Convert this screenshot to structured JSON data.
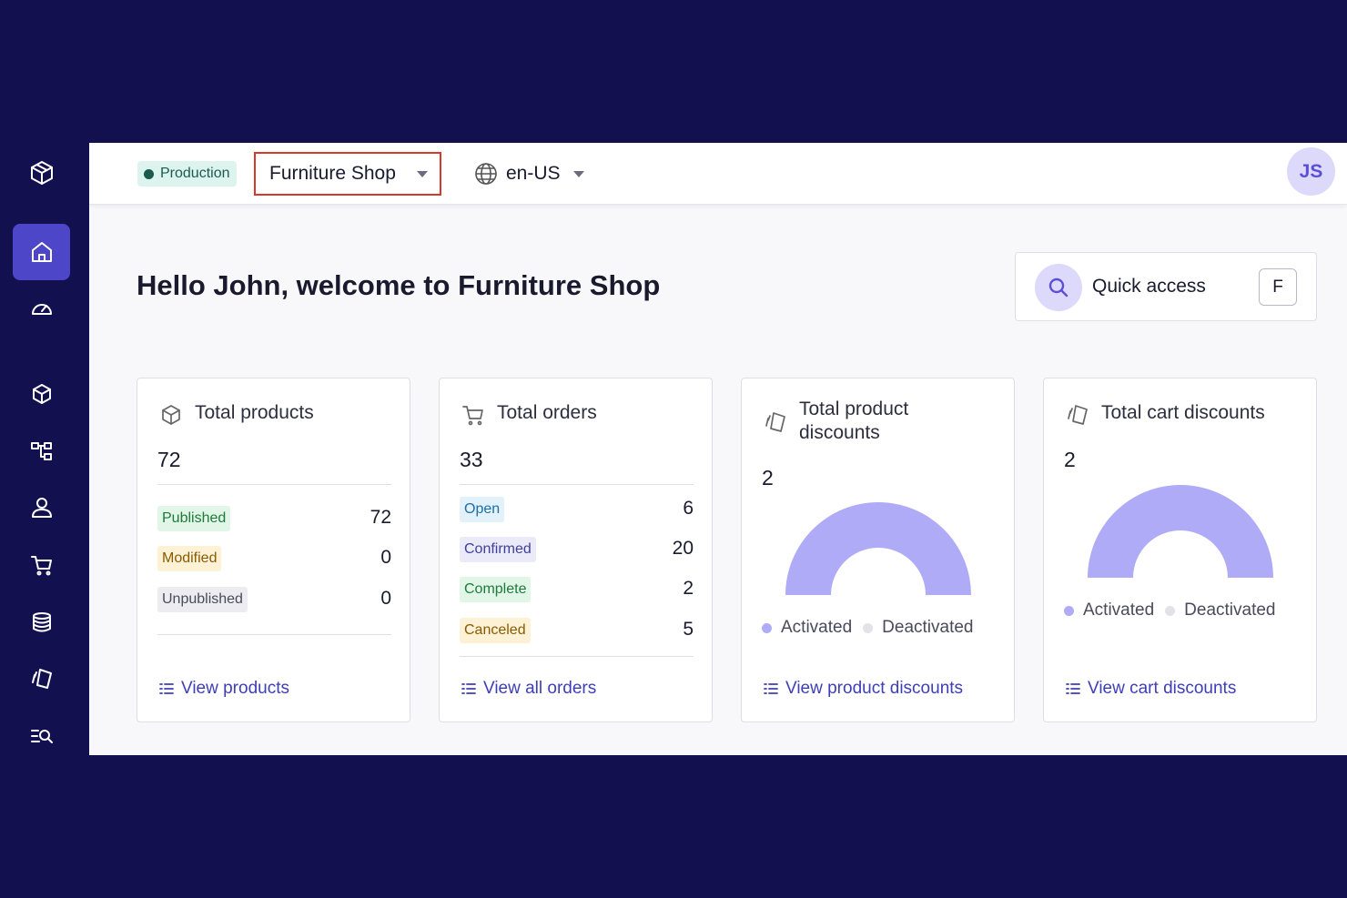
{
  "sidebar": {
    "items": [
      {
        "name": "logo",
        "icon": "cube-logo-icon"
      },
      {
        "name": "dashboard",
        "icon": "home-icon",
        "active": true
      },
      {
        "name": "performance",
        "icon": "speedometer-icon"
      },
      {
        "name": "products",
        "icon": "box-icon"
      },
      {
        "name": "categories",
        "icon": "tree-icon"
      },
      {
        "name": "customers",
        "icon": "person-icon"
      },
      {
        "name": "orders",
        "icon": "cart-icon"
      },
      {
        "name": "prices",
        "icon": "coins-icon"
      },
      {
        "name": "discounts",
        "icon": "discount-tag-icon"
      },
      {
        "name": "search",
        "icon": "list-search-icon"
      }
    ]
  },
  "topbar": {
    "environment": "Production",
    "project": "Furniture Shop",
    "locale": "en-US",
    "avatar_initials": "JS"
  },
  "main": {
    "welcome": "Hello John, welcome to Furniture Shop",
    "quick_access": {
      "label": "Quick access",
      "shortcut": "F"
    }
  },
  "cards": {
    "products": {
      "title": "Total products",
      "total": "72",
      "rows": [
        {
          "label": "Published",
          "count": "72"
        },
        {
          "label": "Modified",
          "count": "0"
        },
        {
          "label": "Unpublished",
          "count": "0"
        }
      ],
      "link": "View products"
    },
    "orders": {
      "title": "Total orders",
      "total": "33",
      "rows": [
        {
          "label": "Open",
          "count": "6"
        },
        {
          "label": "Confirmed",
          "count": "20"
        },
        {
          "label": "Complete",
          "count": "2"
        },
        {
          "label": "Canceled",
          "count": "5"
        }
      ],
      "link": "View all orders"
    },
    "product_discounts": {
      "title_line1": "Total product",
      "title_line2": "discounts",
      "total": "2",
      "legend": [
        "Activated",
        "Deactivated"
      ],
      "activated": 2,
      "deactivated": 0,
      "link": "View product discounts"
    },
    "cart_discounts": {
      "title": "Total cart discounts",
      "total": "2",
      "legend": [
        "Activated",
        "Deactivated"
      ],
      "activated": 2,
      "deactivated": 0,
      "link": "View cart discounts"
    }
  },
  "colors": {
    "background": "#12104f",
    "accent": "#4d46c9",
    "donut_active": "#b0abf7",
    "donut_inactive": "#e2e2e8"
  }
}
